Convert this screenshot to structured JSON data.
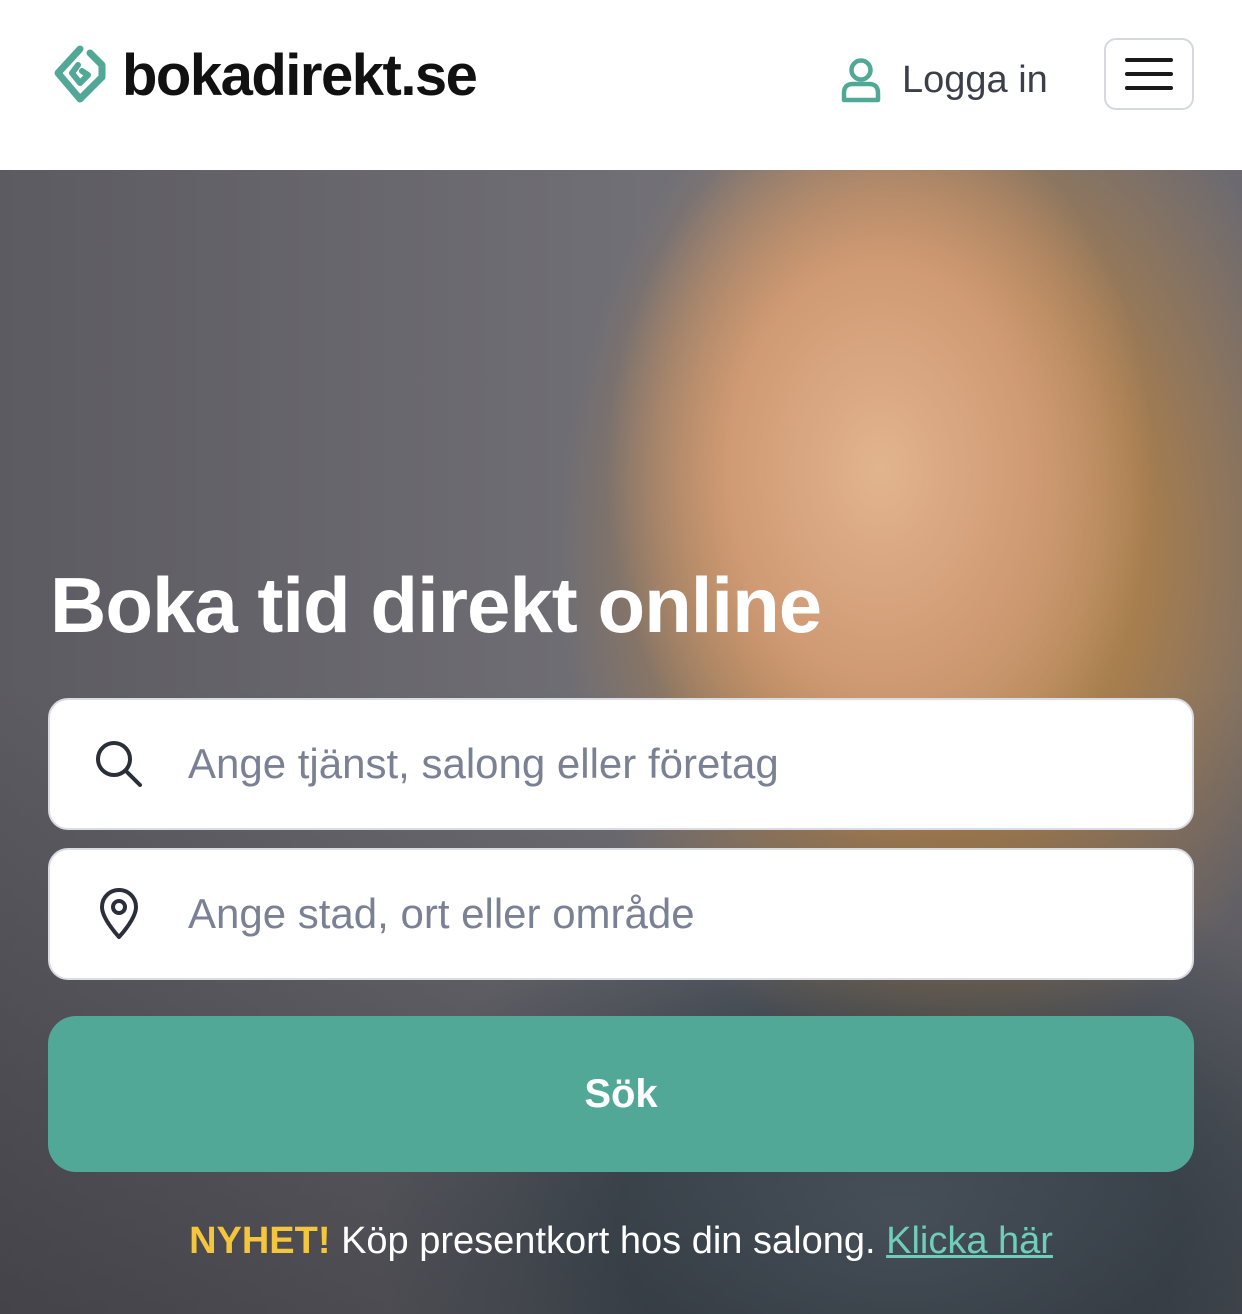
{
  "header": {
    "logo_text": "bokadirekt.se",
    "login_label": "Logga in",
    "menu_icon": "hamburger-icon"
  },
  "hero": {
    "title": "Boka tid direkt online",
    "service_search": {
      "icon": "search-icon",
      "placeholder": "Ange tjänst, salong eller företag",
      "value": ""
    },
    "location_search": {
      "icon": "location-pin-icon",
      "placeholder": "Ange stad, ort eller område",
      "value": ""
    },
    "search_button_label": "Sök",
    "promo": {
      "badge": "NYHET!",
      "text": "Köp presentkort hos din salong.",
      "link": "Klicka här"
    }
  },
  "colors": {
    "brand_green": "#52a896",
    "promo_yellow": "#f4c63d",
    "link_green": "#6fcdb9"
  }
}
